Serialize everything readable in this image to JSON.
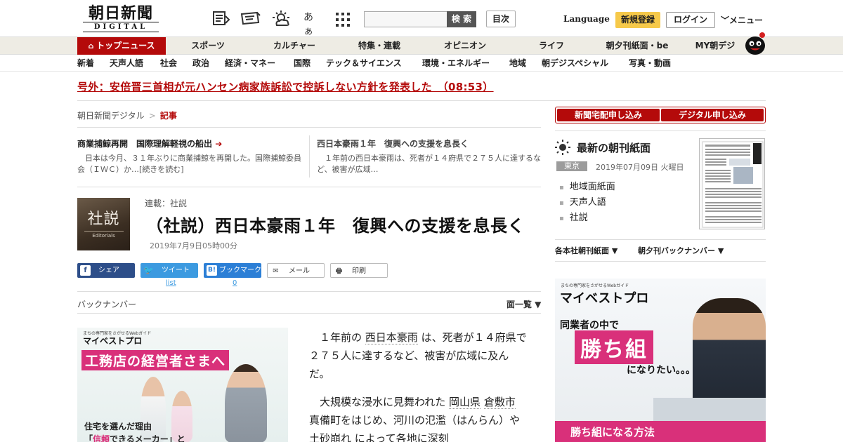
{
  "header": {
    "logo_main": "朝日新聞",
    "logo_sub": "DIGITAL",
    "search_button": "検 索",
    "search_placeholder": "",
    "toc_button": "目次",
    "language": "Language",
    "register": "新規登録",
    "login": "ログイン",
    "menu": "メニュー",
    "font_size_glyph": "あぁ"
  },
  "main_nav": [
    {
      "label": "トップニュース",
      "active": true
    },
    {
      "label": "スポーツ"
    },
    {
      "label": "カルチャー"
    },
    {
      "label": "特集・連載"
    },
    {
      "label": "オピニオン"
    },
    {
      "label": "ライフ"
    },
    {
      "label": "朝夕刊紙面・be"
    },
    {
      "label": "MY朝デジ"
    }
  ],
  "sub_nav": [
    "新着",
    "天声人語",
    "社会",
    "政治",
    "経済・マネー",
    "国際",
    "テック＆サイエンス",
    "環境・エネルギー",
    "地域",
    "朝デジスペシャル",
    "写真・動画"
  ],
  "breaking": "号外：安倍晋三首相が元ハンセン病家族訴訟で控訴しない方針を発表した　（08:53）",
  "breadcrumb": {
    "home": "朝日新聞デジタル",
    "sep": ">",
    "current": "記事"
  },
  "teasers": [
    {
      "title": "商業捕鯨再開　国際理解軽視の船出",
      "arrow": "➔",
      "summary": "日本は今月、３１年ぶりに商業捕鯨を再開した。国際捕鯨委員会（ＩＷＣ）か…[続きを読む]"
    },
    {
      "title": "西日本豪雨１年　復興への支援を息長く",
      "summary": "１年前の西日本豪雨は、死者が１４府県で２７５人に達するなど、被害が広域…"
    }
  ],
  "article": {
    "thumb_kanji": "社説",
    "thumb_en": "Editorials",
    "series": "連載：社説",
    "headline": "（社説）西日本豪雨１年　復興への支援を息長く",
    "date": "2019年7月9日05時00分"
  },
  "share": {
    "facebook": "シェア",
    "facebook_icon": "f",
    "twitter": "ツイート",
    "twitter_icon": "🐦",
    "twitter_sub": "list",
    "hatena": "ブックマーク",
    "hatena_icon": "B!",
    "hatena_count": "0",
    "mail": "メール",
    "mail_icon": "✉",
    "print": "印刷",
    "print_icon": "🖶"
  },
  "backnumber": "バックナンバー",
  "menu_all": "面一覧 ▼",
  "ad_left": {
    "small": "まちの専門家をさがせるWebガイド",
    "brand": "マイベストプロ",
    "main": "工務店の経営者さまへ",
    "line1": "住宅を選んだ理由",
    "line2_pre": "「",
    "line2_hl": "信頼",
    "line2_post": "できるメーカー」と"
  },
  "body": {
    "p1_a": "１年前の",
    "p1_link": "西日本豪雨",
    "p1_b": "は、死者が１４府県で２７５人に達するなど、被害が広域に及んだ。",
    "p2_a": "大規模な浸水に見舞われた",
    "p2_link1": "岡山県",
    "p2_link2": "倉敷市",
    "p2_b": "真備町をはじめ、河川の氾濫（はんらん）や",
    "p2_link3": "土砂崩れ",
    "p2_c": "によって各地に深刻"
  },
  "right": {
    "sub_delivery": "新聞宅配申し込み",
    "sub_digital": "デジタル申し込み",
    "title": "最新の朝刊紙面",
    "location": "東京",
    "date": "2019年07月09日 火曜日",
    "links": [
      "地域面紙面",
      "天声人語",
      "社説"
    ],
    "dd1": "各本社朝刊紙面",
    "dd2": "朝夕刊バックナンバー"
  },
  "ad_right": {
    "small": "まちの専門家をさがせるWebガイド",
    "brand": "マイベストプロ",
    "l1": "同業者の中で",
    "l2": "勝ち組",
    "l3": "になりたい。。。",
    "bottom": "勝ち組になる方法"
  },
  "colors": {
    "brand_red": "#b40a0a",
    "register_yellow": "#f6c94a",
    "ad_pink": "#d9307a"
  }
}
